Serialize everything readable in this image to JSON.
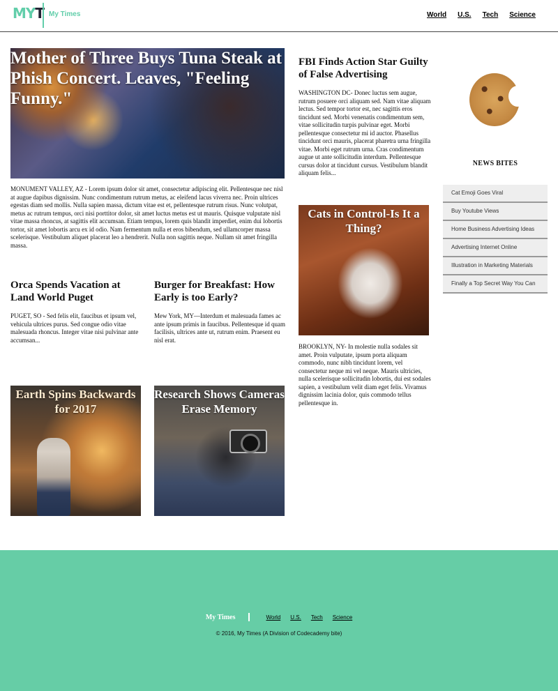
{
  "header": {
    "logo_m": "M",
    "logo_y": "Y",
    "logo_t": "T",
    "brand": "My Times",
    "nav": [
      "World",
      "U.S.",
      "Tech",
      "Science"
    ]
  },
  "hero": {
    "title": "Mother of Three Buys Tuna Steak at Phish Concert. Leaves, \"Feeling Funny.\"",
    "body": "MONUMENT VALLEY, AZ - Lorem ipsum dolor sit amet, consectetur adipiscing elit. Pellentesque nec nisl at augue dapibus dignissim. Nunc condimentum rutrum metus, ac eleifend lacus viverra nec. Proin ultrices egestas diam sed mollis. Nulla sapien massa, dictum vitae est et, pellentesque rutrum risus. Nunc volutpat, metus ac rutrum tempus, orci nisi porttitor dolor, sit amet luctus metus est ut mauris. Quisque vulputate nisl vitae massa rhoncus, at sagittis elit accumsan. Etiam tempus, lorem quis blandit imperdiet, enim dui lobortis tortor, sit amet lobortis arcu ex id odio. Nam fermentum nulla et eros bibendum, sed ullamcorper massa scelerisque. Vestibulum aliquet placerat leo a hendrerit. Nulla non sagittis neque. Nullam sit amet fringilla massa."
  },
  "orca": {
    "title": "Orca Spends Vacation at Land World Puget",
    "body": "PUGET, SO - Sed felis elit, faucibus et ipsum vel, vehicula ultrices purus. Sed congue odio vitae malesuada rhoncus. Integer vitae nisi pulvinar ante accumsan..."
  },
  "burger": {
    "title": "Burger for Breakfast: How Early is too Early?",
    "body": "Mew York, MY—Interdum et malesuada fames ac ante ipsum primis in faucibus. Pellentesque id quam facilisis, ultrices ante ut, rutrum enim. Praesent eu nisl erat."
  },
  "earth": {
    "title": "Earth Spins Backwards for 2017"
  },
  "research": {
    "title": "Research Shows Cameras Erase Memory"
  },
  "fbi": {
    "title": "FBI Finds Action Star Guilty of False Advertising",
    "body": "WASHINGTON DC- Donec luctus sem augue, rutrum posuere orci aliquam sed. Nam vitae aliquam lectus. Sed tempor tortor est, nec sagittis eros tincidunt sed. Morbi venenatis condimentum sem, vitae sollicitudin turpis pulvinar eget. Morbi pellentesque consectetur mi id auctor. Phasellus tincidunt orci mauris, placerat pharetra urna fringilla vitae. Morbi eget rutrum urna. Cras condimentum augue ut ante sollicitudin interdum. Pellentesque cursus dolor at tincidunt cursus. Vestibulum blandit aliquam felis..."
  },
  "cats": {
    "title": "Cats in Control-Is It a Thing?",
    "body": "BROOKLYN, NY- In molestie nulla sodales sit amet. Proin vulputate, ipsum porta aliquam commodo, nunc nibh tincidunt lorem, vel consectetur neque mi vel neque. Mauris ultricies, nulla scelerisque sollicitudin lobortis, dui est sodales sapien, a vestibulum velit diam eget felis. Vivamus dignissim lacinia dolor, quis commodo tellus pellentesque in."
  },
  "sidebar": {
    "title": "NEWS BITES",
    "items": [
      "Cat Emoji Goes Viral",
      "Buy Youtube Views",
      "Home Business Advertising Ideas",
      "Advertising Internet Online",
      "Illustration in Marketing Materials",
      "Finally a Top Secret Way You Can"
    ]
  },
  "footer": {
    "brand": "My Times",
    "links": [
      "World",
      "U.S.",
      "Tech",
      "Science"
    ],
    "copyright": "© 2016, My Times (A Division of Codecademy bite)"
  },
  "colors": {
    "accent": "#62ceaa",
    "footer_bg": "#66cda6"
  }
}
